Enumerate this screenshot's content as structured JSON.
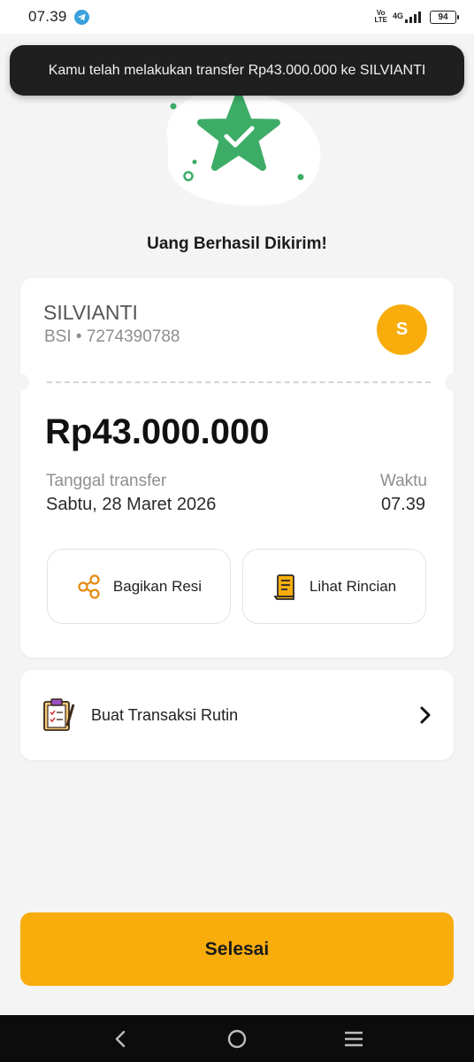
{
  "status_bar": {
    "time": "07.39",
    "network_label": "4G",
    "volte_line1": "Vo",
    "volte_line2": "LTE",
    "battery": "94"
  },
  "toast": {
    "message": "Kamu telah melakukan transfer Rp43.000.000 ke SILVIANTI"
  },
  "headline": "Uang Berhasil Dikirim!",
  "receipt": {
    "recipient_name": "SILVIANTI",
    "bank_account": "BSI • 7274390788",
    "avatar_initial": "S",
    "amount": "Rp43.000.000",
    "date_label": "Tanggal transfer",
    "date_value": "Sabtu, 28 Maret 2026",
    "time_label": "Waktu",
    "time_value": "07.39",
    "share_label": "Bagikan Resi",
    "detail_label": "Lihat Rincian"
  },
  "routine": {
    "label": "Buat Transaksi Rutin"
  },
  "done_button": "Selesai",
  "colors": {
    "accent": "#f8ad0d",
    "success_green": "#3dac67",
    "background": "#f4f4f5"
  },
  "icons": [
    "telegram-icon",
    "signal-icon",
    "battery-icon",
    "star-check-icon",
    "share-icon",
    "receipt-icon",
    "clipboard-icon",
    "chevron-right-icon",
    "back-icon",
    "home-icon",
    "menu-icon"
  ]
}
